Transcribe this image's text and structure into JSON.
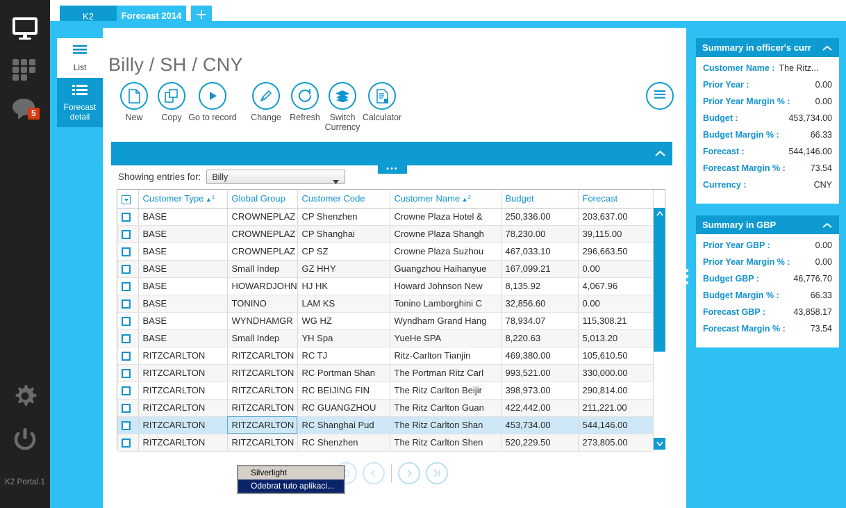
{
  "rail": {
    "icons": [
      {
        "name": "monitor-icon"
      },
      {
        "name": "apps-grid-icon"
      },
      {
        "name": "chat-icon",
        "badge": "5"
      },
      {
        "name": "gear-icon"
      },
      {
        "name": "power-icon"
      }
    ],
    "badge_count": "5",
    "footer_label": "K2 Portal.1"
  },
  "tabs": [
    {
      "label": "K2",
      "active": false
    },
    {
      "label": "Forecast 2014",
      "active": true
    },
    {
      "label": "+",
      "active": false
    }
  ],
  "sidenav": {
    "items": [
      {
        "label": "List",
        "icon": "list-lines-icon",
        "active": true
      },
      {
        "label": "Forecast detail",
        "label_line1": "Forecast",
        "label_line2": "detail",
        "icon": "list-detail-icon",
        "active": false
      }
    ]
  },
  "page": {
    "title": "Billy / SH / CNY"
  },
  "toolbar": {
    "buttons": [
      {
        "label": "New",
        "icon": "document-new-icon"
      },
      {
        "label": "Copy",
        "icon": "copy-icon"
      },
      {
        "label": "Go to record",
        "icon": "play-circle-icon"
      },
      {
        "label": "Change",
        "icon": "pencil-icon"
      },
      {
        "label": "Refresh",
        "icon": "refresh-icon"
      },
      {
        "label": "Switch Currency",
        "label_line1": "Switch",
        "label_line2": "Currency",
        "icon": "layers-icon"
      },
      {
        "label": "Calculator",
        "icon": "calculator-icon"
      }
    ],
    "menu_icon": "hamburger-icon"
  },
  "section_bar": {
    "collapse_icon": "chevron-up-icon",
    "dots_label": "•••"
  },
  "filter": {
    "label": "Showing entries for:",
    "value": "Billy",
    "placeholder": "Billy",
    "options": [
      "Billy"
    ]
  },
  "grid": {
    "columns": [
      {
        "label": "",
        "type": "checkbox"
      },
      {
        "label": "Customer Type",
        "sort": "▲",
        "sort_order": "1",
        "align": "left"
      },
      {
        "label": "Global Group",
        "align": "left"
      },
      {
        "label": "Customer Code",
        "align": "left"
      },
      {
        "label": "Customer Name",
        "sort": "▲",
        "sort_order": "2",
        "align": "left"
      },
      {
        "label": "Budget",
        "align": "right"
      },
      {
        "label": "Forecast",
        "align": "right"
      }
    ],
    "rows": [
      {
        "type": "BASE",
        "group": "CROWNEPLAZ",
        "code": "CP Shenzhen",
        "name": "Crowne Plaza Hotel &",
        "budget": "250,336.00",
        "forecast": "203,637.00",
        "selected": false
      },
      {
        "type": "BASE",
        "group": "CROWNEPLAZ",
        "code": "CP Shanghai",
        "name": "Crowne Plaza Shangh",
        "budget": "78,230.00",
        "forecast": "39,115.00",
        "selected": false
      },
      {
        "type": "BASE",
        "group": "CROWNEPLAZ",
        "code": "CP SZ",
        "name": "Crowne Plaza Suzhou",
        "budget": "467,033.10",
        "forecast": "296,663.50",
        "selected": false
      },
      {
        "type": "BASE",
        "group": "Small Indep",
        "code": "GZ HHY",
        "name": "Guangzhou Haihanyue",
        "budget": "167,099.21",
        "forecast": "0.00",
        "selected": false
      },
      {
        "type": "BASE",
        "group": "HOWARDJOHN",
        "code": "HJ HK",
        "name": "Howard Johnson New",
        "budget": "8,135.92",
        "forecast": "4,067.96",
        "selected": false
      },
      {
        "type": "BASE",
        "group": "TONINO",
        "code": "LAM KS",
        "name": "Tonino Lamborghini C",
        "budget": "32,856.60",
        "forecast": "0.00",
        "selected": false
      },
      {
        "type": "BASE",
        "group": "WYNDHAMGR",
        "code": "WG HZ",
        "name": "Wyndham Grand Hang",
        "budget": "78,934.07",
        "forecast": "115,308.21",
        "selected": false
      },
      {
        "type": "BASE",
        "group": "Small Indep",
        "code": "YH Spa",
        "name": "YueHe SPA",
        "budget": "8,220.63",
        "forecast": "5,013.20",
        "selected": false
      },
      {
        "type": "RITZCARLTON",
        "group": "RITZCARLTON",
        "code": "RC TJ",
        "name": "Ritz-Carlton Tianjin",
        "budget": "469,380.00",
        "forecast": "105,610.50",
        "selected": false
      },
      {
        "type": "RITZCARLTON",
        "group": "RITZCARLTON",
        "code": "RC Portman Shan",
        "name": "The Portman Ritz Carl",
        "budget": "993,521.00",
        "forecast": "330,000.00",
        "selected": false
      },
      {
        "type": "RITZCARLTON",
        "group": "RITZCARLTON",
        "code": "RC BEIJING FIN",
        "name": "The Ritz Carlton Beijir",
        "budget": "398,973.00",
        "forecast": "290,814.00",
        "selected": false
      },
      {
        "type": "RITZCARLTON",
        "group": "RITZCARLTON",
        "code": "RC GUANGZHOU",
        "name": "The Ritz Carlton Guan",
        "budget": "422,442.00",
        "forecast": "211,221.00",
        "selected": false
      },
      {
        "type": "RITZCARLTON",
        "group": "RITZCARLTON",
        "code": "RC Shanghai Pud",
        "name": "The Ritz Carlton Shan",
        "budget": "453,734.00",
        "forecast": "544,146.00",
        "selected": true
      },
      {
        "type": "RITZCARLTON",
        "group": "RITZCARLTON",
        "code": "RC Shenzhen",
        "name": "The Ritz Carlton Shen",
        "budget": "520,229.50",
        "forecast": "273,805.00",
        "selected": false
      }
    ]
  },
  "pager": {
    "buttons": [
      {
        "name": "first-page-button",
        "glyph": "⟨⟨",
        "enabled": false
      },
      {
        "name": "prev-page-button",
        "glyph": "⟨",
        "enabled": false
      },
      {
        "name": "next-page-button",
        "glyph": "⟩",
        "enabled": true
      },
      {
        "name": "last-page-button",
        "glyph": "⟩⟩",
        "enabled": true
      }
    ]
  },
  "context_menu": {
    "items": [
      {
        "label": "Silverlight",
        "selected": false
      },
      {
        "label": "Odebrat tuto aplikaci...",
        "selected": true
      }
    ]
  },
  "summary_officer": {
    "title": "Summary in officer's curr",
    "collapse_icon": "chevron-up-icon",
    "rows": [
      {
        "key": "Customer Name :",
        "value": "The Ritz...",
        "align": "left"
      },
      {
        "key": "Prior Year :",
        "value": "0.00"
      },
      {
        "key": "Prior Year Margin % :",
        "value": "0.00"
      },
      {
        "key": "Budget :",
        "value": "453,734.00"
      },
      {
        "key": "Budget Margin % :",
        "value": "66.33"
      },
      {
        "key": "Forecast :",
        "value": "544,146.00"
      },
      {
        "key": "Forecast Margin % :",
        "value": "73.54"
      },
      {
        "key": "Currency :",
        "value": "CNY"
      }
    ]
  },
  "summary_gbp": {
    "title": "Summary in GBP",
    "collapse_icon": "chevron-up-icon",
    "rows": [
      {
        "key": "Prior Year GBP :",
        "value": "0.00"
      },
      {
        "key": "Prior Year Margin % :",
        "value": "0.00"
      },
      {
        "key": "Budget GBP :",
        "value": "46,776.70"
      },
      {
        "key": "Budget Margin % :",
        "value": "66.33"
      },
      {
        "key": "Forecast GBP :",
        "value": "43,858.17"
      },
      {
        "key": "Forecast Margin % :",
        "value": "73.54"
      }
    ]
  },
  "colors": {
    "rail_bg": "#212121",
    "accent_light": "#2ec0f2",
    "accent": "#0d9bd1",
    "link_blue": "#1293cf",
    "badge_red": "#d83b12",
    "selected_row": "#cfe8f7"
  }
}
